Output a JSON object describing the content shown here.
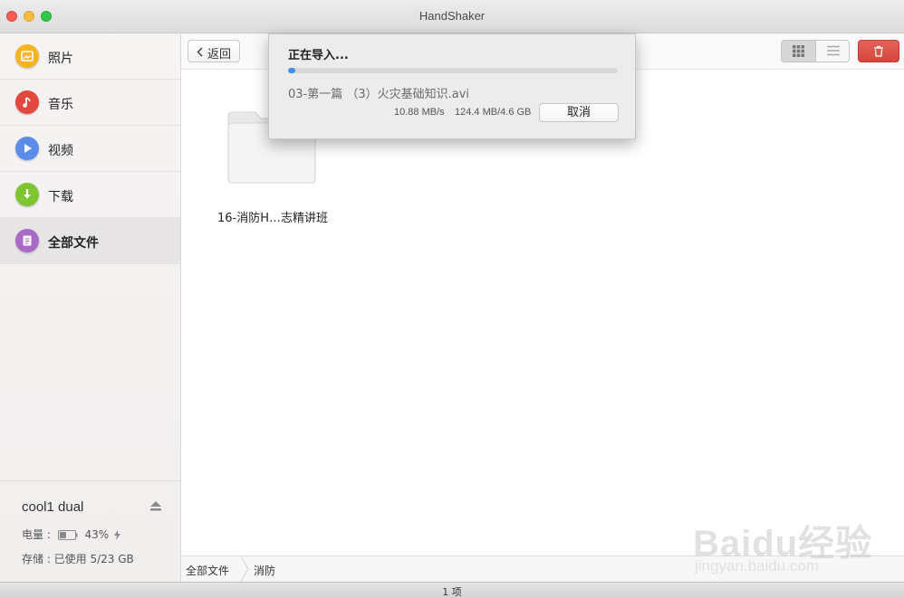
{
  "window": {
    "title": "HandShaker"
  },
  "sidebar": {
    "items": [
      {
        "label": "照片",
        "icon": "photo-icon",
        "color": "#f5b521"
      },
      {
        "label": "音乐",
        "icon": "music-note-icon",
        "color": "#e4473d"
      },
      {
        "label": "视频",
        "icon": "play-icon",
        "color": "#5b8de8"
      },
      {
        "label": "下载",
        "icon": "download-arrow-icon",
        "color": "#7fc531"
      },
      {
        "label": "全部文件",
        "icon": "document-icon",
        "color": "#a76bc7",
        "active": true
      }
    ],
    "device": {
      "name": "cool1 dual",
      "battery_label": "电量 :",
      "battery_value": "43%",
      "battery_level": 0.43,
      "storage_text": "存储 : 已使用 5/23 GB"
    }
  },
  "toolbar": {
    "back_label": "返回",
    "accent_delete": "#d9493f"
  },
  "files": [
    {
      "name": "16-消防H…志精讲班",
      "type": "folder"
    }
  ],
  "pathbar": {
    "crumbs": [
      "全部文件",
      "消防"
    ]
  },
  "status": {
    "count": "1 项"
  },
  "import_dialog": {
    "title": "正在导入...",
    "progress": 0.02,
    "progress_color": "#3d8fef",
    "file_name": "03-第一篇 （3）火灾基础知识.avi",
    "speed": "10.88 MB/s",
    "size": "124.4 MB/4.6 GB",
    "cancel_label": "取消"
  },
  "watermark": {
    "brand": "Baidu经验",
    "url": "jingyan.baidu.com"
  }
}
